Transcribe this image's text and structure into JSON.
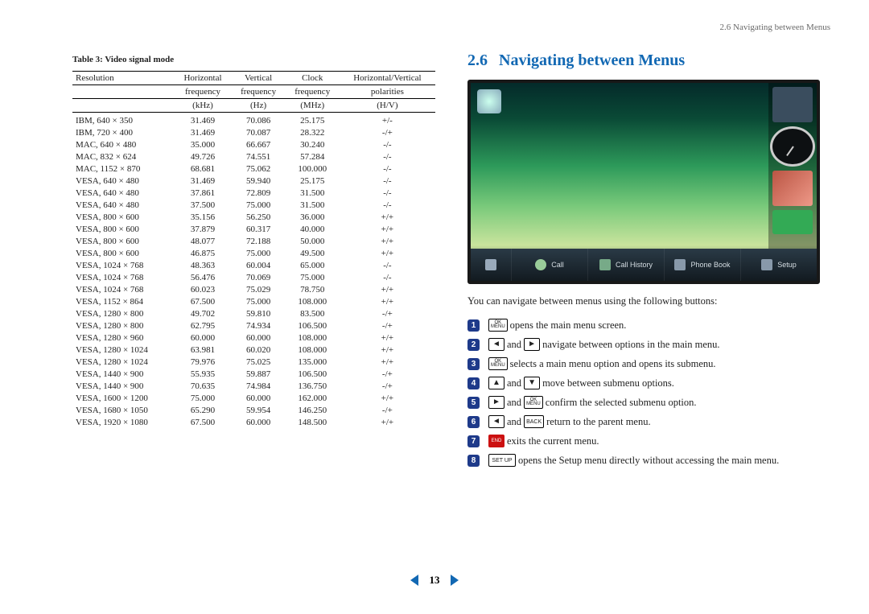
{
  "running_head": "2.6 Navigating between Menus",
  "section": {
    "number": "2.6",
    "title": "Navigating between Menus"
  },
  "table": {
    "caption": "Table 3:  Video signal mode",
    "headers": {
      "c0": "Resolution",
      "c1a": "Horizontal",
      "c1b": "frequency",
      "c1c": "(kHz)",
      "c2a": "Vertical",
      "c2b": "frequency",
      "c2c": "(Hz)",
      "c3a": "Clock",
      "c3b": "frequency",
      "c3c": "(MHz)",
      "c4a": "Horizontal/Vertical",
      "c4b": "polarities",
      "c4c": "(H/V)"
    },
    "rows": [
      {
        "r": "IBM, 640 × 350",
        "h": "31.469",
        "v": "70.086",
        "c": "25.175",
        "p": "+/-"
      },
      {
        "r": "IBM, 720 × 400",
        "h": "31.469",
        "v": "70.087",
        "c": "28.322",
        "p": "-/+"
      },
      {
        "r": "MAC, 640 × 480",
        "h": "35.000",
        "v": "66.667",
        "c": "30.240",
        "p": "-/-"
      },
      {
        "r": "MAC, 832 × 624",
        "h": "49.726",
        "v": "74.551",
        "c": "57.284",
        "p": "-/-"
      },
      {
        "r": "MAC, 1152 × 870",
        "h": "68.681",
        "v": "75.062",
        "c": "100.000",
        "p": "-/-"
      },
      {
        "r": "VESA, 640 × 480",
        "h": "31.469",
        "v": "59.940",
        "c": "25.175",
        "p": "-/-"
      },
      {
        "r": "VESA, 640 × 480",
        "h": "37.861",
        "v": "72.809",
        "c": "31.500",
        "p": "-/-"
      },
      {
        "r": "VESA, 640 × 480",
        "h": "37.500",
        "v": "75.000",
        "c": "31.500",
        "p": "-/-"
      },
      {
        "r": "VESA, 800 × 600",
        "h": "35.156",
        "v": "56.250",
        "c": "36.000",
        "p": "+/+"
      },
      {
        "r": "VESA, 800 × 600",
        "h": "37.879",
        "v": "60.317",
        "c": "40.000",
        "p": "+/+"
      },
      {
        "r": "VESA, 800 × 600",
        "h": "48.077",
        "v": "72.188",
        "c": "50.000",
        "p": "+/+"
      },
      {
        "r": "VESA, 800 × 600",
        "h": "46.875",
        "v": "75.000",
        "c": "49.500",
        "p": "+/+"
      },
      {
        "r": "VESA, 1024 × 768",
        "h": "48.363",
        "v": "60.004",
        "c": "65.000",
        "p": "-/-"
      },
      {
        "r": "VESA, 1024 × 768",
        "h": "56.476",
        "v": "70.069",
        "c": "75.000",
        "p": "-/-"
      },
      {
        "r": "VESA, 1024 × 768",
        "h": "60.023",
        "v": "75.029",
        "c": "78.750",
        "p": "+/+"
      },
      {
        "r": "VESA, 1152 × 864",
        "h": "67.500",
        "v": "75.000",
        "c": "108.000",
        "p": "+/+"
      },
      {
        "r": "VESA, 1280 × 800",
        "h": "49.702",
        "v": "59.810",
        "c": "83.500",
        "p": "-/+"
      },
      {
        "r": "VESA, 1280 × 800",
        "h": "62.795",
        "v": "74.934",
        "c": "106.500",
        "p": "-/+"
      },
      {
        "r": "VESA, 1280 × 960",
        "h": "60.000",
        "v": "60.000",
        "c": "108.000",
        "p": "+/+"
      },
      {
        "r": "VESA, 1280 × 1024",
        "h": "63.981",
        "v": "60.020",
        "c": "108.000",
        "p": "+/+"
      },
      {
        "r": "VESA, 1280 × 1024",
        "h": "79.976",
        "v": "75.025",
        "c": "135.000",
        "p": "+/+"
      },
      {
        "r": "VESA, 1440 × 900",
        "h": "55.935",
        "v": "59.887",
        "c": "106.500",
        "p": "-/+"
      },
      {
        "r": "VESA, 1440 × 900",
        "h": "70.635",
        "v": "74.984",
        "c": "136.750",
        "p": "-/+"
      },
      {
        "r": "VESA, 1600 × 1200",
        "h": "75.000",
        "v": "60.000",
        "c": "162.000",
        "p": "+/+"
      },
      {
        "r": "VESA, 1680 × 1050",
        "h": "65.290",
        "v": "59.954",
        "c": "146.250",
        "p": "-/+"
      },
      {
        "r": "VESA, 1920 × 1080",
        "h": "67.500",
        "v": "60.000",
        "c": "148.500",
        "p": "+/+"
      }
    ]
  },
  "screenshot": {
    "dock": {
      "call": "Call",
      "history": "Call History",
      "book": "Phone Book",
      "setup": "Setup"
    }
  },
  "intro": "You can navigate between menus using the following buttons:",
  "keys": {
    "ok_top": "OK",
    "ok_bot": "MENU",
    "back": "BACK",
    "end": "END",
    "setup": "SET UP",
    "left": "◄",
    "right": "►",
    "up": "▲",
    "down": "▼",
    "dot": "•"
  },
  "steps": {
    "s1": " opens the main menu screen.",
    "s2a": " and ",
    "s2b": " navigate between options in the main menu.",
    "s3": " selects a main menu option and opens its submenu.",
    "s4a": " and ",
    "s4b": " move between submenu options.",
    "s5a": " and ",
    "s5b": " confirm the selected submenu option.",
    "s6a": " and ",
    "s6b": " return to the parent menu.",
    "s7": " exits the current menu.",
    "s8": " opens the Setup menu directly without accessing the main menu."
  },
  "pager": {
    "page": "13"
  },
  "chart_data": {
    "type": "table",
    "title": "Table 3: Video signal mode",
    "columns": [
      "Resolution",
      "Horizontal frequency (kHz)",
      "Vertical frequency (Hz)",
      "Clock frequency (MHz)",
      "Horizontal/Vertical polarities (H/V)"
    ],
    "rows": [
      [
        "IBM, 640 × 350",
        31.469,
        70.086,
        25.175,
        "+/-"
      ],
      [
        "IBM, 720 × 400",
        31.469,
        70.087,
        28.322,
        "-/+"
      ],
      [
        "MAC, 640 × 480",
        35.0,
        66.667,
        30.24,
        "-/-"
      ],
      [
        "MAC, 832 × 624",
        49.726,
        74.551,
        57.284,
        "-/-"
      ],
      [
        "MAC, 1152 × 870",
        68.681,
        75.062,
        100.0,
        "-/-"
      ],
      [
        "VESA, 640 × 480",
        31.469,
        59.94,
        25.175,
        "-/-"
      ],
      [
        "VESA, 640 × 480",
        37.861,
        72.809,
        31.5,
        "-/-"
      ],
      [
        "VESA, 640 × 480",
        37.5,
        75.0,
        31.5,
        "-/-"
      ],
      [
        "VESA, 800 × 600",
        35.156,
        56.25,
        36.0,
        "+/+"
      ],
      [
        "VESA, 800 × 600",
        37.879,
        60.317,
        40.0,
        "+/+"
      ],
      [
        "VESA, 800 × 600",
        48.077,
        72.188,
        50.0,
        "+/+"
      ],
      [
        "VESA, 800 × 600",
        46.875,
        75.0,
        49.5,
        "+/+"
      ],
      [
        "VESA, 1024 × 768",
        48.363,
        60.004,
        65.0,
        "-/-"
      ],
      [
        "VESA, 1024 × 768",
        56.476,
        70.069,
        75.0,
        "-/-"
      ],
      [
        "VESA, 1024 × 768",
        60.023,
        75.029,
        78.75,
        "+/+"
      ],
      [
        "VESA, 1152 × 864",
        67.5,
        75.0,
        108.0,
        "+/+"
      ],
      [
        "VESA, 1280 × 800",
        49.702,
        59.81,
        83.5,
        "-/+"
      ],
      [
        "VESA, 1280 × 800",
        62.795,
        74.934,
        106.5,
        "-/+"
      ],
      [
        "VESA, 1280 × 960",
        60.0,
        60.0,
        108.0,
        "+/+"
      ],
      [
        "VESA, 1280 × 1024",
        63.981,
        60.02,
        108.0,
        "+/+"
      ],
      [
        "VESA, 1280 × 1024",
        79.976,
        75.025,
        135.0,
        "+/+"
      ],
      [
        "VESA, 1440 × 900",
        55.935,
        59.887,
        106.5,
        "-/+"
      ],
      [
        "VESA, 1440 × 900",
        70.635,
        74.984,
        136.75,
        "-/+"
      ],
      [
        "VESA, 1600 × 1200",
        75.0,
        60.0,
        162.0,
        "+/+"
      ],
      [
        "VESA, 1680 × 1050",
        65.29,
        59.954,
        146.25,
        "-/+"
      ],
      [
        "VESA, 1920 × 1080",
        67.5,
        60.0,
        148.5,
        "+/+"
      ]
    ]
  }
}
